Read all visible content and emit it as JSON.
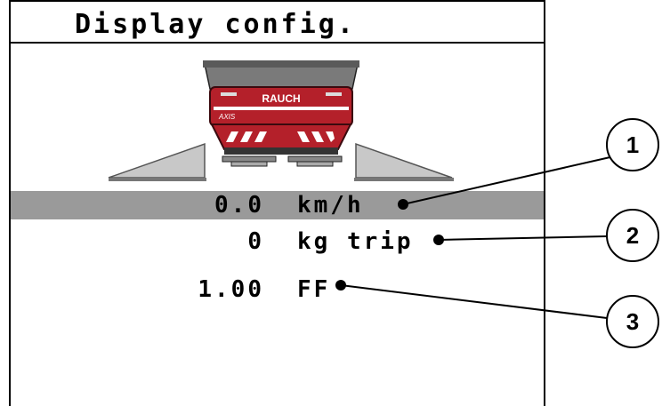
{
  "title": "Display config.",
  "brand": "RAUCH",
  "model": "AXIS",
  "rows": [
    {
      "value": "0.0",
      "unit": "km/h",
      "selected": true
    },
    {
      "value": "0",
      "unit": "kg trip",
      "selected": false
    },
    {
      "value": "1.00",
      "unit": "FF",
      "selected": false
    }
  ],
  "callouts": [
    "1",
    "2",
    "3"
  ],
  "colors": {
    "highlight": "#9a9a9a",
    "spreader_red": "#b4202a",
    "ramp_gray": "#bfbfbf"
  }
}
